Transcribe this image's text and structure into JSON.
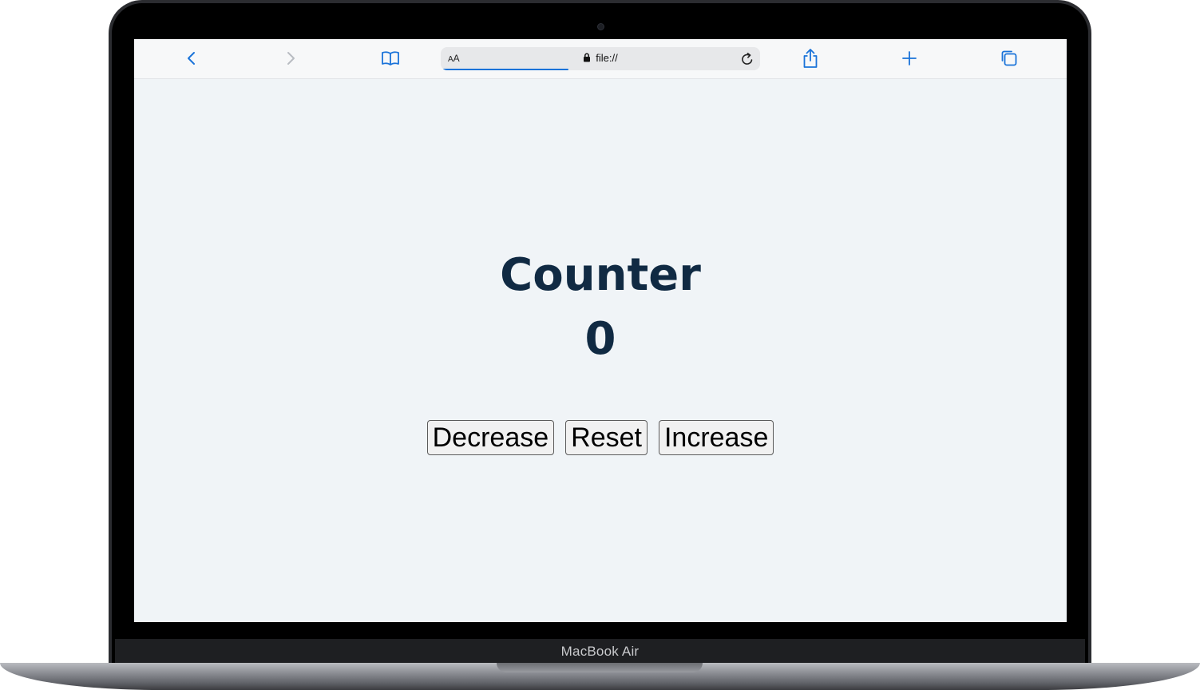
{
  "device": {
    "brand_label": "MacBook Air"
  },
  "browser": {
    "address": {
      "reader_label_large": "A",
      "reader_label_small": "A",
      "url": "file://",
      "load_progress": 0.4
    },
    "icons": {
      "back": "chevron-left-icon",
      "forward": "chevron-right-icon",
      "bookmarks": "book-icon",
      "lock": "lock-icon",
      "reload": "reload-icon",
      "share": "share-icon",
      "new_tab": "plus-icon",
      "tabs": "tabs-icon"
    },
    "accent_color": "#1a73d9"
  },
  "page": {
    "title": "Counter",
    "count": "0",
    "buttons": {
      "decrease": "Decrease",
      "reset": "Reset",
      "increase": "Increase"
    },
    "text_color": "#102a43",
    "background_color": "#f0f4f7"
  }
}
